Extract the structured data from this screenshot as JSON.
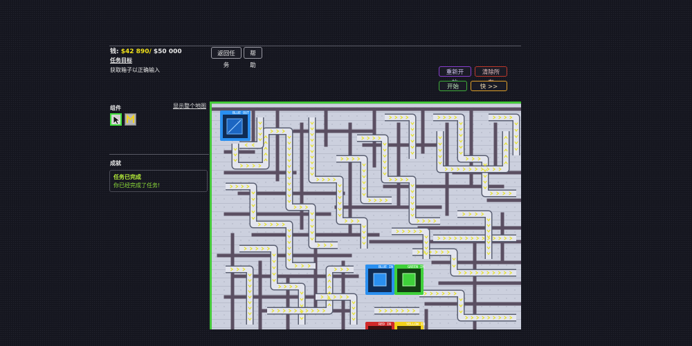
{
  "money": {
    "label": "钱:",
    "current": "$42 890",
    "separator": "/",
    "target": " $50 000"
  },
  "objective": {
    "title": "任务目标",
    "text": "获取箱子以正确输入"
  },
  "header_buttons": {
    "back": "返回任务",
    "help": "帮助"
  },
  "controls": {
    "restart": "重新开始",
    "clear_all": "清除所有",
    "start": "开始",
    "fast": "快 >>"
  },
  "colors": {
    "restart": "#8a3fd1",
    "clear_all": "#c0392b",
    "start": "#3fae3a",
    "fast": "#e0a12a",
    "map_border": "#44c93a",
    "money": "#f2e21a",
    "achievement": "#b9f23a",
    "blue": "#2a8ff0",
    "green": "#3fd13a",
    "red": "#d12a2a",
    "yellow": "#f2d21a"
  },
  "components": {
    "title": "组件",
    "show_map": "显示整个地图",
    "tools": [
      {
        "name": "pointer-icon",
        "selected": true
      },
      {
        "name": "conveyor-m-icon",
        "selected": false
      }
    ]
  },
  "achievements": {
    "title": "成就",
    "items": [
      {
        "title": "任务已完成",
        "text": "你已经完成了任务!"
      }
    ]
  },
  "stations": [
    {
      "label": "BLUE OUT",
      "color": "blue"
    },
    {
      "label": "BLUE IN",
      "color": "blue"
    },
    {
      "label": "GREEN IN",
      "color": "green"
    },
    {
      "label": "RED IN",
      "color": "red"
    },
    {
      "label": "YELLOW IN",
      "color": "yellow"
    }
  ]
}
